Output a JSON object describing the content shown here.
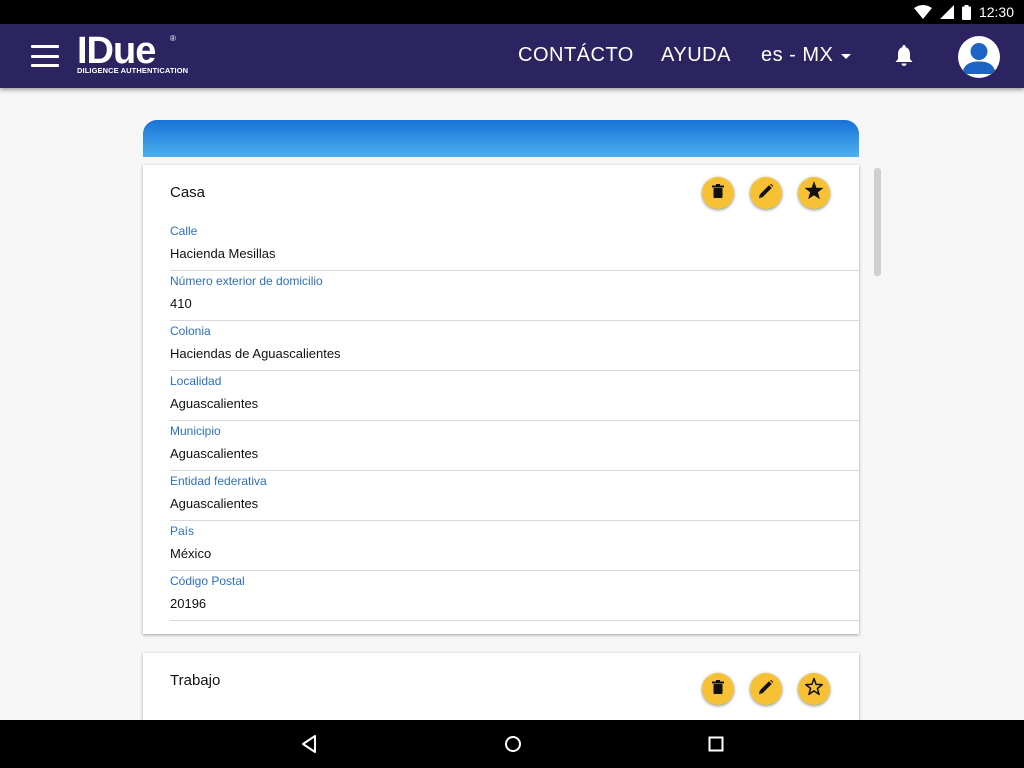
{
  "status_bar": {
    "time": "12:30"
  },
  "header": {
    "brand": "IDue",
    "brand_mark": "®",
    "tagline": "DILIGENCE AUTHENTICATION",
    "nav_contact": "CONTÁCTO",
    "nav_help": "AYUDA",
    "language": "es - MX"
  },
  "colors": {
    "appbar": "#2b2461",
    "accent": "#f7c135",
    "label": "#2d6fbd",
    "header_gradient": [
      "#1872d8",
      "#4db1ee"
    ]
  },
  "icons": [
    "menu-icon",
    "bell-icon",
    "user-icon",
    "trash-icon",
    "pencil-icon",
    "star-icon",
    "star-outline-icon",
    "back-icon",
    "home-icon",
    "recents-icon",
    "wifi-icon",
    "signal-icon",
    "battery-icon"
  ],
  "addresses": [
    {
      "title": "Casa",
      "favorite": true,
      "fields": [
        {
          "label": "Calle",
          "value": "Hacienda Mesillas"
        },
        {
          "label": "Número exterior de domicilio",
          "value": "410"
        },
        {
          "label": "Colonia",
          "value": "Haciendas de Aguascalientes"
        },
        {
          "label": "Localidad",
          "value": "Aguascalientes"
        },
        {
          "label": "Municipio",
          "value": "Aguascalientes"
        },
        {
          "label": "Entidad federativa",
          "value": "Aguascalientes"
        },
        {
          "label": "País",
          "value": "México"
        },
        {
          "label": "Código Postal",
          "value": "20196"
        }
      ]
    },
    {
      "title": "Trabajo",
      "favorite": false
    }
  ]
}
